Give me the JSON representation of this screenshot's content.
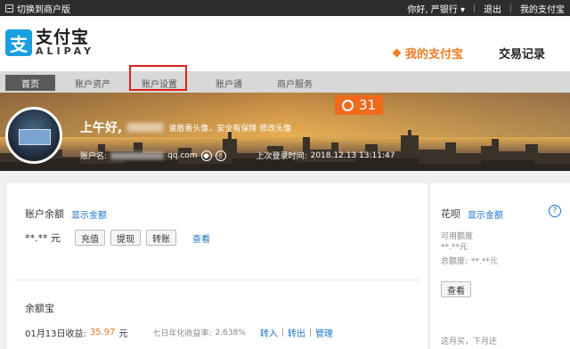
{
  "topbar": {
    "switch_label": "切换到商户版",
    "greeting": "你好,",
    "username": "严银行",
    "logout": "退出",
    "my_alipay": "我的支付宝",
    "bg_color": "#2d2d2d"
  },
  "header": {
    "logo_cn": "支付宝",
    "logo_en": "ALIPAY",
    "logo_mark": "支",
    "nav_active": "我的支付宝",
    "nav_other": "交易记录",
    "accent": "#f07c22",
    "brand": "#1a9fe0"
  },
  "subnav": {
    "tabs": [
      "首页",
      "账户资产",
      "账户设置",
      "账户通",
      "商户服务"
    ],
    "highlighted": "账户设置"
  },
  "banner": {
    "greeting": "上午好,",
    "tip": "诶散看头像，安全有保障 修改头像",
    "account_label": "账户名:",
    "account_suffix": "qq.com",
    "last_login_label": "上次登录时间:",
    "last_login_time": "2018.12.13 13:11:47",
    "days_badge": "31"
  },
  "balance": {
    "title": "账户余额",
    "show_amount": "显示金额",
    "amount": "**.** 元",
    "buttons": [
      "充值",
      "提现",
      "转账"
    ],
    "view": "查看"
  },
  "yuebao": {
    "title": "余额宝",
    "income_label": "01月13日收益:",
    "income_value": "35.97",
    "income_unit": "元",
    "rate_label": "七日年化收益率:",
    "rate_value": "2.638%",
    "actions": [
      "转入",
      "转出",
      "管理"
    ]
  },
  "huabei": {
    "title": "花呗",
    "show_amount": "显示金额",
    "available_label": "可用额度",
    "available_value": "**.**元",
    "total_label": "总额度:",
    "total_value": "**.**元",
    "view": "查看",
    "footer": "这月买，下月还",
    "help_icon": "?"
  }
}
